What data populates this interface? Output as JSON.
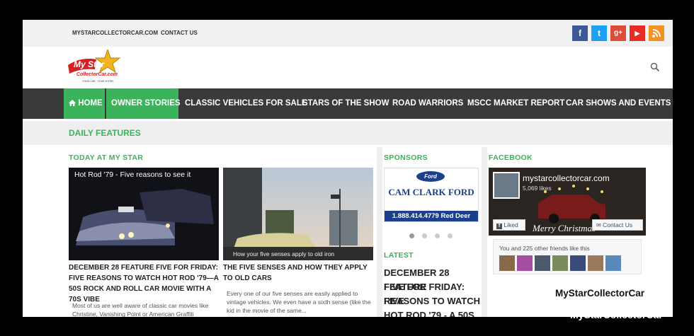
{
  "topbar": {
    "site_link": "MYSTARCOLLECTORCAR.COM",
    "contact_link": "CONTACT US",
    "social": [
      {
        "name": "facebook-icon",
        "glyph": "f",
        "color": "#3b5998"
      },
      {
        "name": "twitter-icon",
        "glyph": "t",
        "color": "#1da1f2"
      },
      {
        "name": "google-plus-icon",
        "glyph": "g+",
        "color": "#dd4b39"
      },
      {
        "name": "youtube-icon",
        "glyph": "▶",
        "color": "#e52d27"
      },
      {
        "name": "rss-icon",
        "glyph": ")",
        "color": "#f29220"
      }
    ]
  },
  "logo": {
    "line1": "My Star",
    "line2": "CollectorCar.com",
    "tagline": "YOUR CAR · YOUR STORY"
  },
  "nav": {
    "home": "HOME",
    "owner_stories": "OWNER STORIES",
    "classic": "CLASSIC VEHICLES FOR SALE",
    "stars": "STARS OF THE SHOW",
    "road": "ROAD WARRIORS",
    "market": "MSCC MARKET REPORT",
    "events": "CAR SHOWS AND EVENTS"
  },
  "daily_features": "DAILY FEATURES",
  "today": {
    "title": "TODAY AT MY STAR",
    "articles": [
      {
        "image_caption": "Hot Rod '79 - Five reasons to see it",
        "headline": "DECEMBER 28 FEATURE FIVE FOR FRIDAY: FIVE REASONS TO WATCH HOT ROD '79—A 50S ROCK AND ROLL CAR MOVIE WITH A 70S VIBE",
        "excerpt": "Most of us are well aware of classic car movies like Christine, Vanishing Point or American Graffiti"
      },
      {
        "image_caption": "How your five senses apply to old iron",
        "headline": "THE FIVE SENSES AND HOW THEY APPLY TO OLD CARS",
        "excerpt": "Every one of our five senses are easily applied to vintage vehicles.  We even have a sixth sense (like the kid in the movie of the same..."
      }
    ]
  },
  "sponsors": {
    "title": "SPONSORS",
    "ford_oval": "Ford",
    "dealer": "CAM CLARK FORD",
    "phone": "1.888.414.4779 Red Deer"
  },
  "latest": {
    "title": "LATEST",
    "lines": [
      "DECEMBER 28 FEATURE",
      "FIVE FOR FRIDAY: FIVE",
      "REASONS TO WATCH",
      "HOT ROD '79 - A 50S"
    ]
  },
  "facebook": {
    "title": "FACEBOOK",
    "page_name": "mystarcollectorcar.com",
    "likes": "5,069 likes",
    "liked_button": "Liked",
    "contact_button": "Contact Us",
    "banner_text": "Merry Christmas",
    "friends_text": "You and 225 other friends like this"
  },
  "watermark": {
    "dark": "MyStarCollectorCar",
    "light": "MyStarCollectorCar"
  },
  "colors": {
    "accent": "#3bb35a",
    "nav_bg": "#3a3a3a",
    "nav_active": "#3bb35a"
  }
}
